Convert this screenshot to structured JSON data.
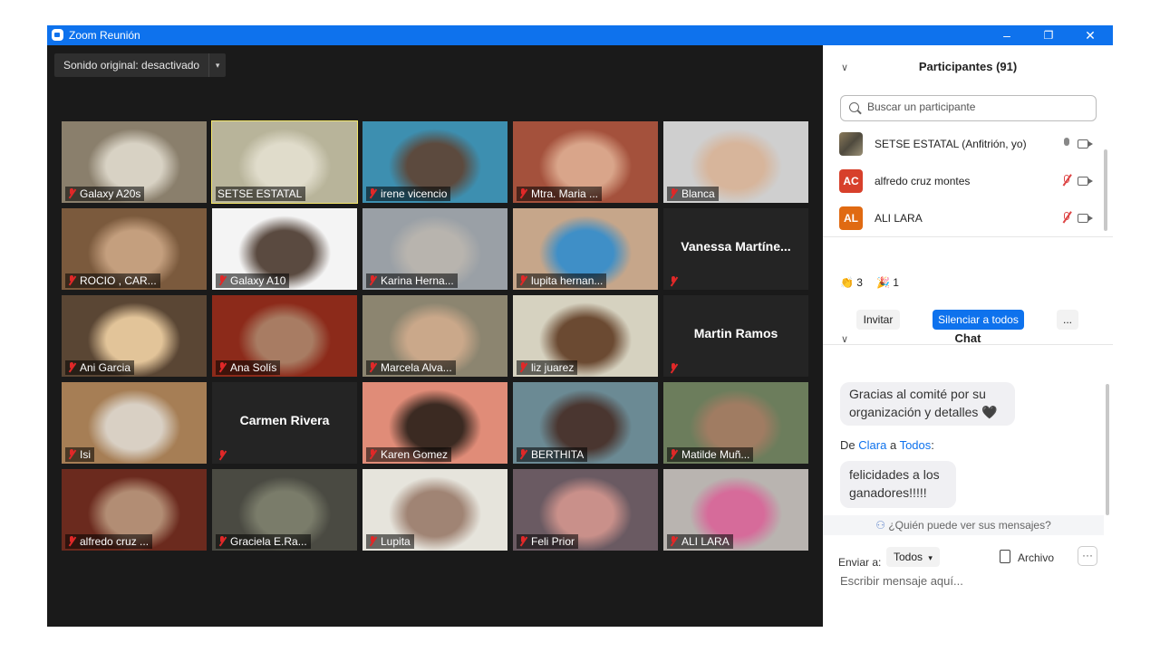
{
  "window": {
    "title": "Zoom Reunión",
    "minimize": "–",
    "maximize": "❐",
    "close": "✕"
  },
  "sound_button": {
    "label": "Sonido original: desactivado",
    "caret": "▾"
  },
  "tiles": [
    {
      "name": "Galaxy A20s",
      "muted": true,
      "video": true,
      "bg": "#8a7f6c",
      "inner": "#d8d2c4"
    },
    {
      "name": "SETSE ESTATAL",
      "muted": false,
      "video": true,
      "active": true,
      "bg": "#b8b49a",
      "inner": "#e0dccb"
    },
    {
      "name": "irene vicencio",
      "muted": true,
      "video": true,
      "bg": "#3d8fb0",
      "inner": "#5c4a3e"
    },
    {
      "name": "Mtra. Maria ...",
      "muted": true,
      "video": true,
      "bg": "#a4513c",
      "inner": "#d9a58a"
    },
    {
      "name": "Blanca",
      "muted": true,
      "video": true,
      "bg": "#cfcfcf",
      "inner": "#d7b59b"
    },
    {
      "name": "ROCIO , CAR...",
      "muted": true,
      "video": true,
      "bg": "#7b5a3d",
      "inner": "#c49f7e"
    },
    {
      "name": "Galaxy A10",
      "muted": true,
      "video": true,
      "bg": "#f4f4f4",
      "inner": "#5a4a40"
    },
    {
      "name": "Karina Herna...",
      "muted": true,
      "video": true,
      "bg": "#9aa0a6",
      "inner": "#b8b4ae"
    },
    {
      "name": "lupita hernan...",
      "muted": true,
      "video": true,
      "bg": "#c6a68a",
      "inner": "#3f8fc7"
    },
    {
      "name": "Vanessa  Martíne...",
      "muted": true,
      "video": false
    },
    {
      "name": "Ani Garcia",
      "muted": true,
      "video": true,
      "bg": "#5a4634",
      "inner": "#e2c499"
    },
    {
      "name": "Ana Solís",
      "muted": true,
      "video": true,
      "bg": "#8c2a1a",
      "inner": "#a87c63"
    },
    {
      "name": "Marcela Alva...",
      "muted": true,
      "video": true,
      "bg": "#8c8570",
      "inner": "#caa88a"
    },
    {
      "name": "liz juarez",
      "muted": true,
      "video": true,
      "bg": "#d6d2c0",
      "inner": "#6b4a32"
    },
    {
      "name": "Martin Ramos",
      "muted": true,
      "video": false
    },
    {
      "name": "Isi",
      "muted": true,
      "video": true,
      "bg": "#a67e55",
      "inner": "#d9d0c4"
    },
    {
      "name": "Carmen Rivera",
      "muted": true,
      "video": false
    },
    {
      "name": "Karen Gomez",
      "muted": true,
      "video": true,
      "bg": "#e08c78",
      "inner": "#3b2a22"
    },
    {
      "name": "BERTHITA",
      "muted": true,
      "video": true,
      "bg": "#6b8a94",
      "inner": "#4a3630"
    },
    {
      "name": "Matilde Muñ...",
      "muted": true,
      "video": true,
      "bg": "#6c7d5c",
      "inner": "#a07c62"
    },
    {
      "name": "alfredo cruz ...",
      "muted": true,
      "video": true,
      "bg": "#6b2a1e",
      "inner": "#b28d74"
    },
    {
      "name": "Graciela E.Ra...",
      "muted": true,
      "video": true,
      "bg": "#4a4a42",
      "inner": "#7a7c6a"
    },
    {
      "name": "Lupita",
      "muted": true,
      "video": true,
      "bg": "#e6e4dc",
      "inner": "#a08474"
    },
    {
      "name": "Feli Prior",
      "muted": true,
      "video": true,
      "bg": "#6a5a62",
      "inner": "#c9908a"
    },
    {
      "name": "ALI LARA",
      "muted": true,
      "video": true,
      "bg": "#b9b4b0",
      "inner": "#d66b9a"
    }
  ],
  "participants": {
    "title": "Participantes (91)",
    "search_placeholder": "Buscar un participante",
    "list": [
      {
        "name": "SETSE ESTATAL (Anfitrión, yo)",
        "initials": "",
        "color": "#6e6a5a",
        "muted": false
      },
      {
        "name": "alfredo cruz montes",
        "initials": "AC",
        "color": "#d7402b",
        "muted": true
      },
      {
        "name": "ALI LARA",
        "initials": "AL",
        "color": "#e06a12",
        "muted": true
      }
    ],
    "reactions": {
      "clap_icon": "👏",
      "clap_count": "3",
      "party_icon": "🎉",
      "party_count": "1"
    },
    "invite_label": "Invitar",
    "mute_all_label": "Silenciar a todos",
    "more_label": "..."
  },
  "chat": {
    "title": "Chat",
    "msg1": "Gracias al comité por su organización y detalles 🖤",
    "from_prefix": "De",
    "from_name": "Clara",
    "from_mid": "a",
    "from_to": "Todos",
    "from_suffix": ":",
    "msg2": "felicidades a los ganadores!!!!!",
    "who_sees": "¿Quién puede ver sus mensajes?",
    "send_to_label": "Enviar a:",
    "send_to_value": "Todos",
    "file_label": "Archivo",
    "more_label": "···",
    "compose_placeholder": "Escribir mensaje aquí..."
  },
  "colors": {
    "titlebar": "#0e72ed",
    "mute_all_button": "#0e72ed",
    "muted_icon": "#e02828"
  }
}
